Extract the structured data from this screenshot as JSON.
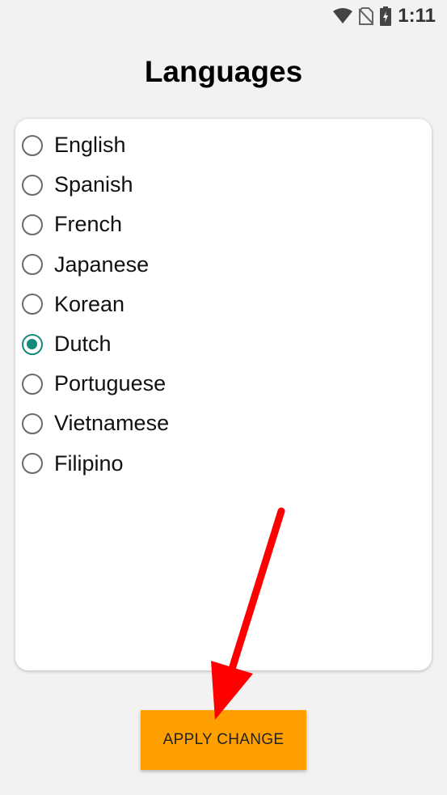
{
  "status_bar": {
    "time": "1:11",
    "icons": [
      "wifi-icon",
      "no-sim-icon",
      "battery-charging-icon"
    ]
  },
  "page": {
    "title": "Languages"
  },
  "languages": {
    "selected": "Dutch",
    "accent_color": "#148a7a",
    "options": [
      {
        "label": "English",
        "checked": false
      },
      {
        "label": "Spanish",
        "checked": false
      },
      {
        "label": "French",
        "checked": false
      },
      {
        "label": "Japanese",
        "checked": false
      },
      {
        "label": "Korean",
        "checked": false
      },
      {
        "label": "Dutch",
        "checked": true
      },
      {
        "label": "Portuguese",
        "checked": false
      },
      {
        "label": "Vietnamese",
        "checked": false
      },
      {
        "label": "Filipino",
        "checked": false
      }
    ]
  },
  "actions": {
    "apply_label": "APPLY CHANGE",
    "apply_color": "#ffa000"
  },
  "annotation": {
    "arrow_color": "#ff0000"
  }
}
